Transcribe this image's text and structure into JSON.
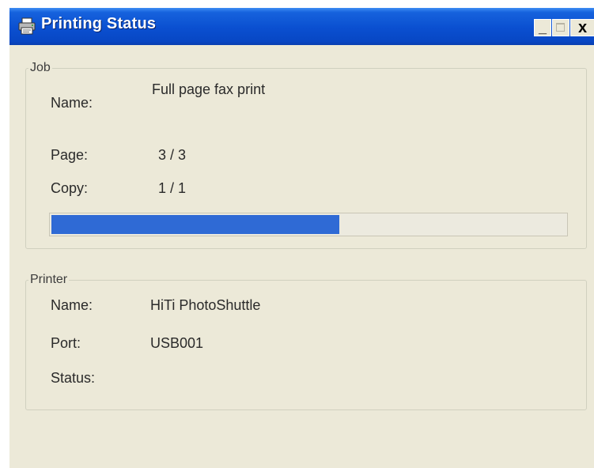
{
  "window": {
    "title": "Printing Status",
    "icon": "printer-icon",
    "controls": {
      "minimize": "_",
      "maximize": "",
      "close": "x"
    }
  },
  "job": {
    "legend": "Job",
    "name_label": "Name:",
    "name_value": "Full page fax print",
    "page_label": "Page:",
    "page_value": "3 / 3",
    "copy_label": "Copy:",
    "copy_value": "1 / 1",
    "progress_fraction": 0.56
  },
  "printer": {
    "legend": "Printer",
    "name_label": "Name:",
    "name_value": "HiTi PhotoShuttle",
    "port_label": "Port:",
    "port_value": "USB001",
    "status_label": "Status:",
    "status_value": ""
  },
  "colors": {
    "titlebar": "#0a4fd0",
    "window_bg": "#ece9d8",
    "progress_fill": "#2f6ad5"
  }
}
